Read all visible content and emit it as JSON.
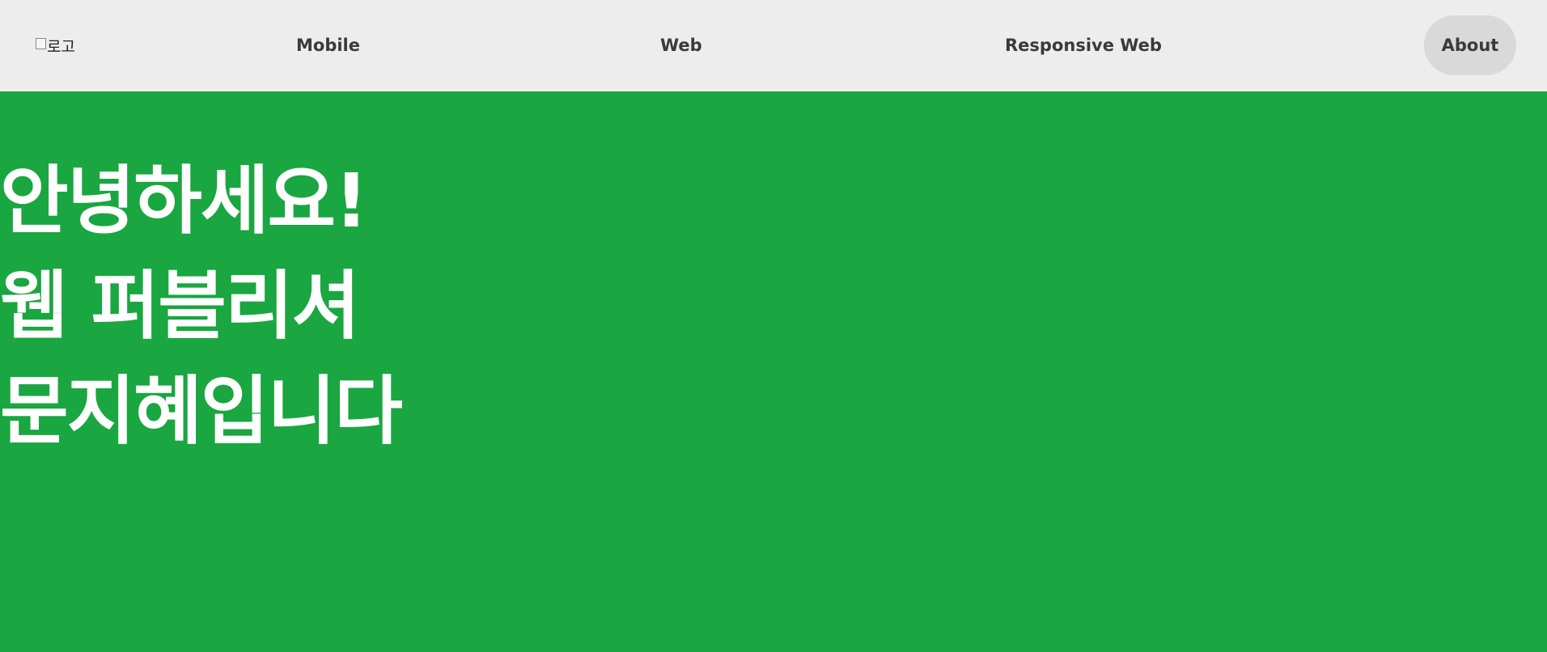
{
  "header": {
    "logo_alt": "로고",
    "nav": {
      "mobile": "Mobile",
      "web": "Web",
      "responsive_web": "Responsive Web",
      "about": "About"
    }
  },
  "hero": {
    "line1": "안녕하세요!",
    "line2": "웹 퍼블리셔",
    "line3": "문지혜입니다"
  },
  "colors": {
    "header_bg": "#ededed",
    "hero_bg": "#1aa640",
    "active_nav_bg": "#d9d9d9",
    "hero_text": "#ffffff"
  }
}
